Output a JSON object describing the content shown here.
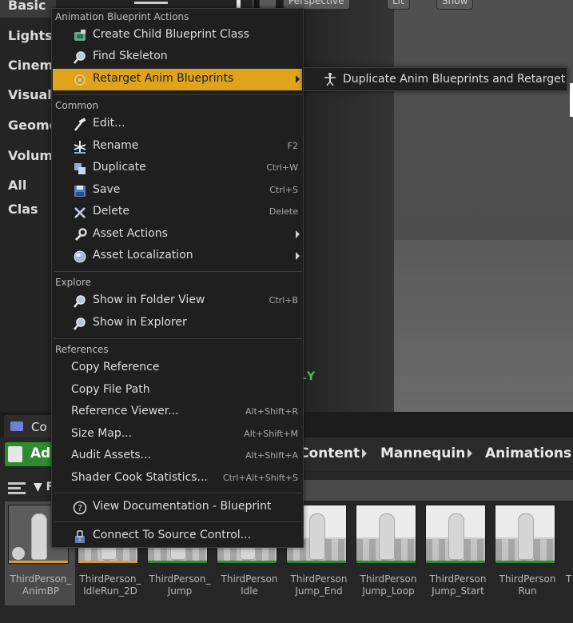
{
  "modes": {
    "categories": [
      "Basic",
      "Lights",
      "Cinema",
      "Visual",
      "Geome",
      "Volume",
      "All Clas"
    ]
  },
  "viewport": {
    "buttons": [
      "Perspective",
      "Lit",
      "Show"
    ],
    "axis_label": "Y"
  },
  "context_menu": {
    "sections": {
      "animation": "Animation Blueprint Actions",
      "common": "Common",
      "explore": "Explore",
      "references": "References"
    },
    "animation_items": [
      {
        "label": "Create Child Blueprint Class",
        "icon": "blueprint-child-icon"
      },
      {
        "label": "Find Skeleton",
        "icon": "magnifier-icon"
      },
      {
        "label": "Retarget Anim Blueprints",
        "icon": "retarget-icon",
        "has_submenu": true,
        "highlighted": true
      }
    ],
    "common_items": [
      {
        "label": "Edit...",
        "icon": "edit-hammer-icon",
        "shortcut": ""
      },
      {
        "label": "Rename",
        "icon": "rename-icon",
        "shortcut": "F2"
      },
      {
        "label": "Duplicate",
        "icon": "duplicate-icon",
        "shortcut": "Ctrl+W"
      },
      {
        "label": "Save",
        "icon": "save-disk-icon",
        "shortcut": "Ctrl+S"
      },
      {
        "label": "Delete",
        "icon": "delete-x-icon",
        "shortcut": "Delete"
      },
      {
        "label": "Asset Actions",
        "icon": "wrench-icon",
        "has_submenu": true
      },
      {
        "label": "Asset Localization",
        "icon": "globe-icon",
        "has_submenu": true
      }
    ],
    "explore_items": [
      {
        "label": "Show in Folder View",
        "icon": "magnifier-icon",
        "shortcut": "Ctrl+B"
      },
      {
        "label": "Show in Explorer",
        "icon": "magnifier-icon",
        "shortcut": ""
      }
    ],
    "reference_items": [
      {
        "label": "Copy Reference",
        "shortcut": ""
      },
      {
        "label": "Copy File Path",
        "shortcut": ""
      },
      {
        "label": "Reference Viewer...",
        "shortcut": "Alt+Shift+R"
      },
      {
        "label": "Size Map...",
        "shortcut": "Alt+Shift+M"
      },
      {
        "label": "Audit Assets...",
        "shortcut": "Alt+Shift+A"
      },
      {
        "label": "Shader Cook Statistics...",
        "shortcut": "Ctrl+Alt+Shift+S"
      }
    ],
    "documentation": "View Documentation - Blueprint",
    "source_control": "Connect To Source Control..."
  },
  "submenu": {
    "label": "Duplicate Anim Blueprints and Retarget",
    "icon": "skeleton-icon"
  },
  "content_browser": {
    "tab_label": "Co",
    "add_button": "Add",
    "breadcrumbs": [
      "Content",
      "Mannequin",
      "Animations"
    ],
    "filter_label": "F",
    "assets": [
      {
        "name": "ThirdPerson_\nAnimBP",
        "selected": true
      },
      {
        "name": "ThirdPerson_\nIdleRun_2D"
      },
      {
        "name": "ThirdPerson_\nJump"
      },
      {
        "name": "ThirdPerson\nIdle"
      },
      {
        "name": "ThirdPerson\nJump_End"
      },
      {
        "name": "ThirdPerson\nJump_Loop"
      },
      {
        "name": "ThirdPerson\nJump_Start"
      },
      {
        "name": "ThirdPerson\nRun"
      },
      {
        "name": "T"
      }
    ]
  },
  "colors": {
    "highlight": "#e0a41b",
    "add_button": "#2e8c2e",
    "axis_green": "#3ec43e"
  }
}
